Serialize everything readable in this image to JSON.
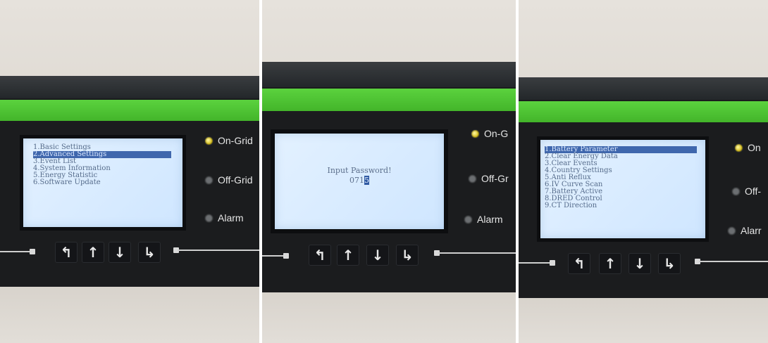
{
  "panel1": {
    "menu": [
      "1.Basic Settings",
      "2.Advanced Settings",
      "3.Event List",
      "4.System Information",
      "5.Energy Statistic",
      "6.Software Update"
    ],
    "selected_index": 1
  },
  "panel2": {
    "title": "Input Password!",
    "password_value": "071",
    "cursor_char": "5"
  },
  "panel3": {
    "menu": [
      "1.Battery Parameter",
      "2.Clear Energy Data",
      "3.Clear Events",
      "4.Country Settings",
      "5.Anti Reflux",
      "6.IV Curve Scan",
      "7.Battery Active",
      "8.DRED Control",
      "9.CT Direction"
    ],
    "selected_index": 0
  },
  "leds": {
    "on_grid": "On-Grid",
    "on_grid_cut2": "On-G",
    "on_grid_cut3": "On",
    "off_grid": "Off-Grid",
    "off_grid_cut2": "Off-Gr",
    "off_grid_cut3": "Off-",
    "alarm": "Alarm",
    "alarm_cut3": "Alarr"
  },
  "buttons": {
    "back": "↰",
    "up": "↑",
    "down": "↓",
    "enter": "↳"
  },
  "colors": {
    "green_band": "#4cc433",
    "lcd_bg": "#d9ecff",
    "highlight": "#3f67ad"
  }
}
